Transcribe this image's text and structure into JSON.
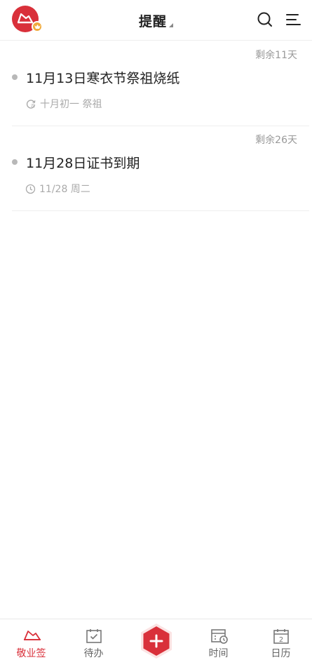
{
  "header": {
    "title": "提醒",
    "logo_icon": "app-logo-icon",
    "search_icon": "search-icon",
    "menu_icon": "menu-icon"
  },
  "reminders": [
    {
      "remaining": "剩余11天",
      "title": "11月13日寒衣节祭祖烧纸",
      "meta": "十月初一 祭祖",
      "meta_icon": "lunar-repeat-icon"
    },
    {
      "remaining": "剩余26天",
      "title": "11月28日证书到期",
      "meta": "11/28 周二",
      "meta_icon": "clock-icon"
    }
  ],
  "tabbar": {
    "tabs": [
      {
        "label": "敬业签",
        "icon": "notes-hat-icon",
        "active": true
      },
      {
        "label": "待办",
        "icon": "todo-check-icon",
        "active": false
      },
      {
        "label": "",
        "icon": "add-icon",
        "active": false
      },
      {
        "label": "时间",
        "icon": "time-calendar-icon",
        "active": false
      },
      {
        "label": "日历",
        "icon": "calendar-icon",
        "active": false
      }
    ]
  },
  "colors": {
    "brand": "#d9303a",
    "badge": "#f0a93a",
    "muted_text": "#999999",
    "divider": "#eeeeee"
  }
}
